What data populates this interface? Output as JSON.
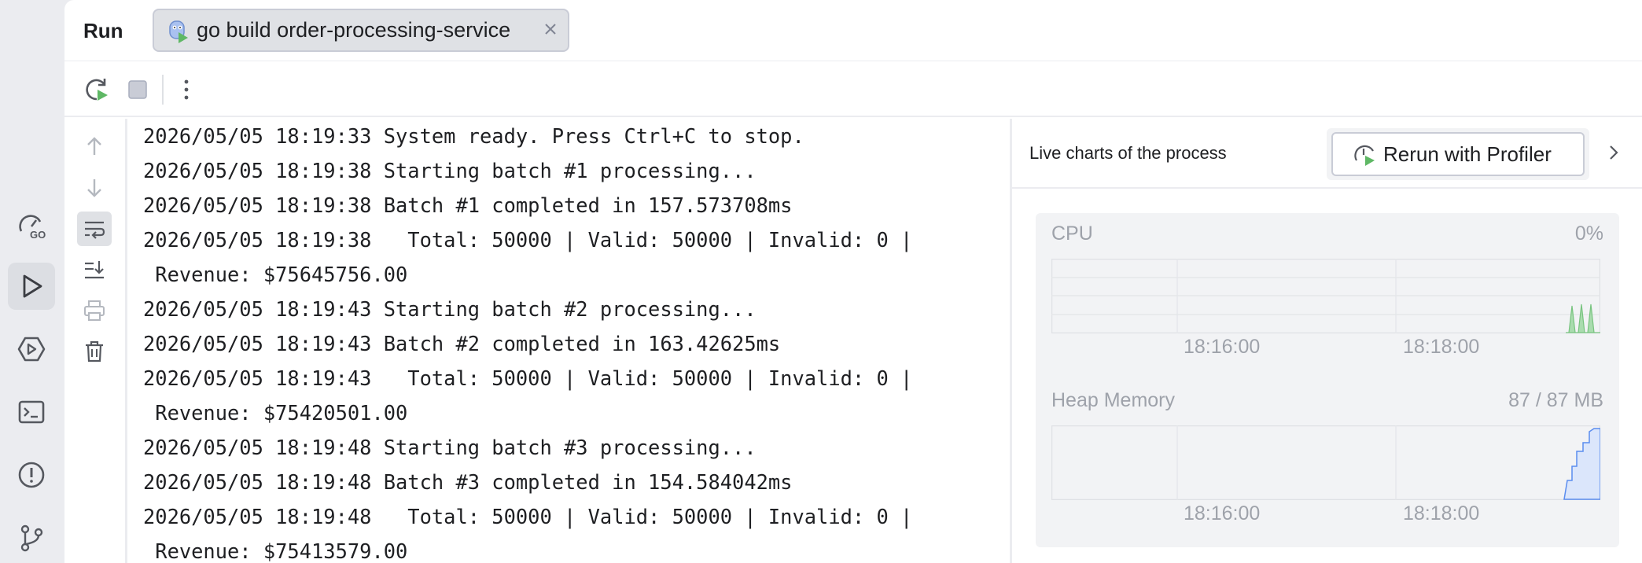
{
  "activity_bar": {
    "items": [
      {
        "name": "go-profiler-icon"
      },
      {
        "name": "run-icon",
        "active": true
      },
      {
        "name": "services-icon"
      },
      {
        "name": "terminal-icon"
      },
      {
        "name": "problems-icon"
      },
      {
        "name": "git-icon"
      }
    ]
  },
  "header": {
    "title": "Run",
    "tab_label": "go build order-processing-service"
  },
  "console": {
    "lines": [
      "2026/05/05 18:19:33 System ready. Press Ctrl+C to stop.",
      "2026/05/05 18:19:38 Starting batch #1 processing...",
      "2026/05/05 18:19:38 Batch #1 completed in 157.573708ms",
      "2026/05/05 18:19:38   Total: 50000 | Valid: 50000 | Invalid: 0 |",
      " Revenue: $75645756.00",
      "2026/05/05 18:19:43 Starting batch #2 processing...",
      "2026/05/05 18:19:43 Batch #2 completed in 163.42625ms",
      "2026/05/05 18:19:43   Total: 50000 | Valid: 50000 | Invalid: 0 |",
      " Revenue: $75420501.00",
      "2026/05/05 18:19:48 Starting batch #3 processing...",
      "2026/05/05 18:19:48 Batch #3 completed in 154.584042ms",
      "2026/05/05 18:19:48   Total: 50000 | Valid: 50000 | Invalid: 0 |",
      " Revenue: $75413579.00"
    ]
  },
  "live_charts": {
    "title": "Live charts of the process",
    "rerun_label": "Rerun with Profiler",
    "cpu": {
      "label": "CPU",
      "value": "0%",
      "ticks": [
        "18:16:00",
        "18:18:00"
      ]
    },
    "heap": {
      "label": "Heap Memory",
      "value": "87 / 87 MB",
      "ticks": [
        "18:16:00",
        "18:18:00"
      ]
    }
  },
  "colors": {
    "accent_green": "#5fb865",
    "heap_fill": "#dbe6fb",
    "heap_line": "#5b8def",
    "cpu_fill": "#a9dcae"
  }
}
